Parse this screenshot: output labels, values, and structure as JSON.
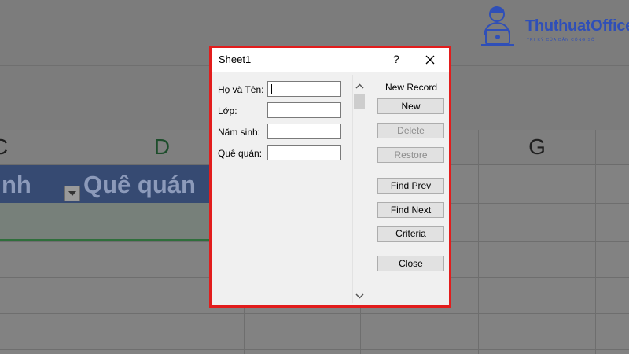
{
  "spreadsheet": {
    "columns": [
      {
        "letter": "C",
        "active": false
      },
      {
        "letter": "D",
        "active": true
      },
      {
        "letter": "G",
        "active": false
      }
    ],
    "header_cells": [
      "nh",
      "Quê quán"
    ]
  },
  "logo": {
    "name": "ThuthuatOffice",
    "tagline": "TRI KỲ CỦA DÂN CÔNG SỞ"
  },
  "dialog": {
    "title": "Sheet1",
    "help": "?",
    "fields": [
      {
        "label": "Họ và Tên:",
        "value": ""
      },
      {
        "label": "Lớp:",
        "value": ""
      },
      {
        "label": "Năm sinh:",
        "value": ""
      },
      {
        "label": "Quê quán:",
        "value": ""
      }
    ],
    "record_status": "New Record",
    "buttons": {
      "new": "New",
      "delete": "Delete",
      "restore": "Restore",
      "find_prev": "Find Prev",
      "find_next": "Find Next",
      "criteria": "Criteria",
      "close": "Close"
    }
  }
}
